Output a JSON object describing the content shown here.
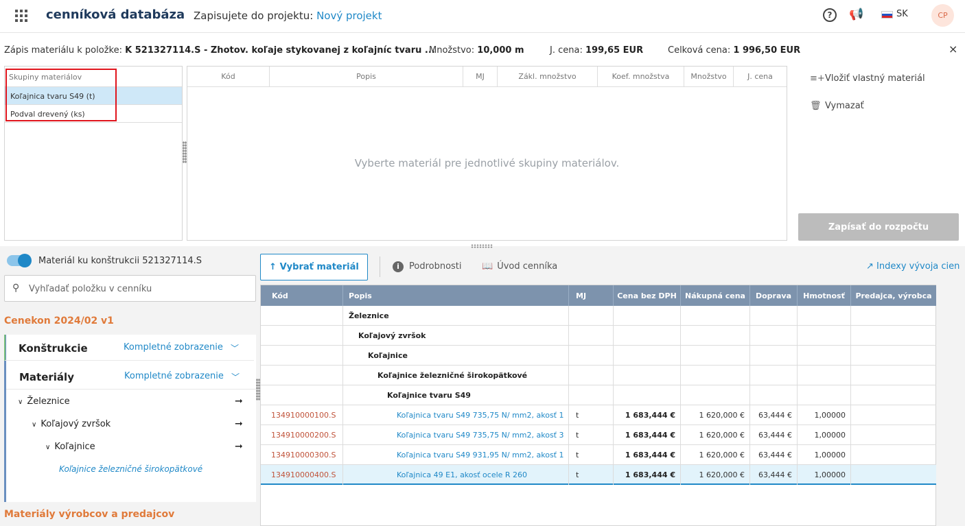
{
  "header": {
    "app_title": "cenníková databáza",
    "project_prefix": "Zapisujete do projektu:",
    "project_name": "Nový projekt",
    "help_icon": "?",
    "language": "SK",
    "avatar_initials": "CP"
  },
  "infobar": {
    "label": "Zápis materiálu k položke:",
    "item": "K 521327114.S - Zhotov. koľaje stykovanej z koľajníc tvaru ...",
    "qty_label": "Množstvo:",
    "qty_value": "10,000 m",
    "unit_label": "J. cena:",
    "unit_value": "199,65 EUR",
    "total_label": "Celková cena:",
    "total_value": "1 996,50 EUR",
    "close_icon": "×"
  },
  "groups": {
    "header": "Skupiny materiálov",
    "items": [
      {
        "label": "Koľajnica tvaru S49 (t)",
        "selected": true
      },
      {
        "label": "Podval drevený (ks)",
        "selected": false
      }
    ]
  },
  "materials": {
    "columns": [
      "Kód",
      "Popis",
      "MJ",
      "Zákl. množstvo",
      "Koef. množstva",
      "Množstvo",
      "J. cena"
    ],
    "empty_message": "Vyberte materiál pre jednotlivé skupiny materiálov."
  },
  "actions": {
    "insert_label": "Vložiť vlastný materiál",
    "delete_label": "Vymazať",
    "write_label": "Zapísať do rozpočtu"
  },
  "lower_left": {
    "toggle_label": "Materiál ku konštrukcii 521327114.S",
    "search_placeholder": "Vyhľadať položku v cenníku",
    "catalog_title": "Cenekon 2024/02 v1",
    "sections": [
      {
        "name": "Konštrukcie",
        "mode": "Kompletné zobrazenie"
      },
      {
        "name": "Materiály",
        "mode": "Kompletné zobrazenie"
      }
    ],
    "tree": [
      "Železnice",
      "Koľajový zvršok",
      "Koľajnice"
    ],
    "tree_leaf": "Koľajnice železničné širokopätkové",
    "bottom_section": "Materiály výrobcov a predajcov"
  },
  "toolbar": {
    "pick_label": "Vybrať materiál",
    "details_label": "Podrobnosti",
    "intro_label": "Úvod cenníka",
    "index_label": "Indexy vývoja cien"
  },
  "grid": {
    "columns": [
      "Kód",
      "Popis",
      "MJ",
      "Cena bez DPH",
      "Nákupná cena",
      "Doprava",
      "Hmotnosť",
      "Predajca, výrobca"
    ],
    "category_rows": [
      "Železnice",
      "Koľajový zvršok",
      "Koľajnice",
      "Koľajnice železničné širokopätkové",
      "Koľajnice tvaru S49"
    ],
    "rows": [
      {
        "code": "134910000100.S",
        "desc": "Koľajnica tvaru S49 735,75 N/ mm2, akosť 1",
        "mj": "t",
        "price": "1 683,444 €",
        "purchase": "1 620,000 €",
        "transport": "63,444 €",
        "weight": "1,00000",
        "vendor": ""
      },
      {
        "code": "134910000200.S",
        "desc": "Koľajnica tvaru S49 735,75 N/ mm2, akosť 3",
        "mj": "t",
        "price": "1 683,444 €",
        "purchase": "1 620,000 €",
        "transport": "63,444 €",
        "weight": "1,00000",
        "vendor": ""
      },
      {
        "code": "134910000300.S",
        "desc": "Koľajnica tvaru S49 931,95 N/ mm2, akosť 1",
        "mj": "t",
        "price": "1 683,444 €",
        "purchase": "1 620,000 €",
        "transport": "63,444 €",
        "weight": "1,00000",
        "vendor": ""
      },
      {
        "code": "134910000400.S",
        "desc": "Koľajnica 49 E1, akosť ocele R 260",
        "mj": "t",
        "price": "1 683,444 €",
        "purchase": "1 620,000 €",
        "transport": "63,444 €",
        "weight": "1,00000",
        "vendor": "",
        "selected": true
      }
    ]
  }
}
